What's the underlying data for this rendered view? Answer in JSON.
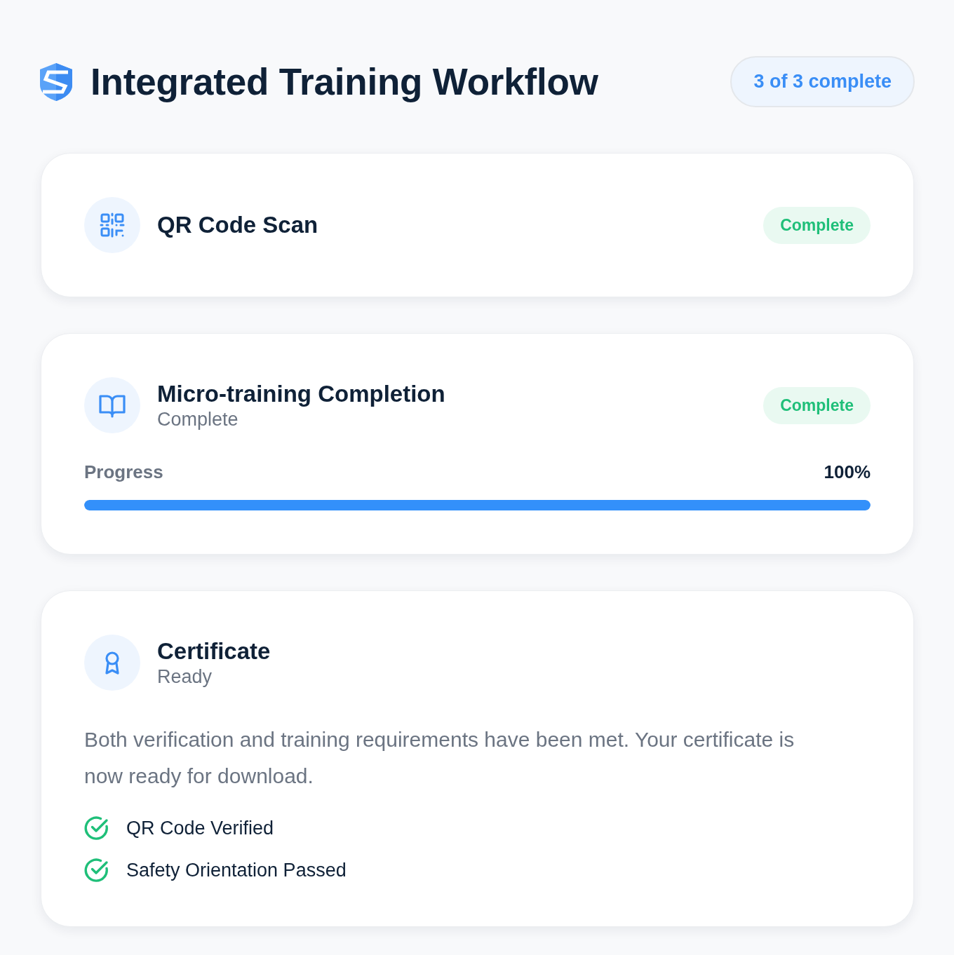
{
  "header": {
    "title": "Integrated Training Workflow",
    "progress_badge": "3 of 3 complete"
  },
  "steps": [
    {
      "kind": "qr",
      "title": "QR Code Scan",
      "status": "Complete"
    },
    {
      "kind": "training",
      "title": "Micro-training Completion",
      "subtitle": "Complete",
      "status": "Complete",
      "progress": {
        "label": "Progress",
        "reading": "100%",
        "level": 1
      }
    },
    {
      "kind": "certificate",
      "title": "Certificate",
      "subtitle": "Ready",
      "description": "Both verification and training requirements have been met. Your certificate is now ready for download.",
      "checklist": [
        {
          "label": "QR Code Verified",
          "checked": true
        },
        {
          "label": "Safety Orientation Passed",
          "checked": true
        }
      ]
    }
  ]
}
